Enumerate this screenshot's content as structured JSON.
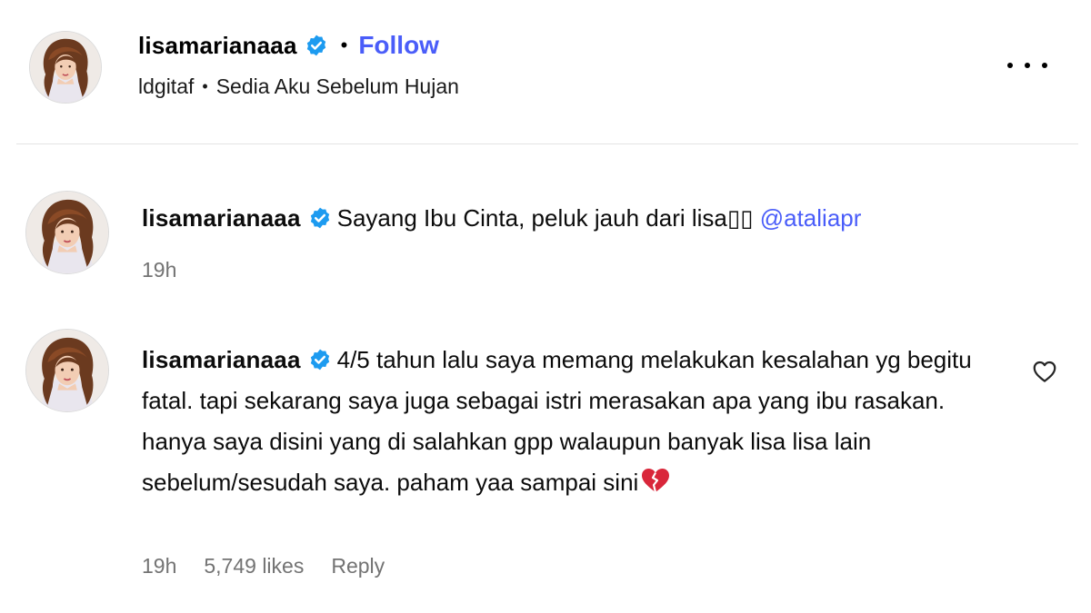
{
  "post_header": {
    "username": "lisamarianaaa",
    "follow_label": "Follow",
    "separator": "•",
    "audio_artist": "ldgitaf",
    "audio_title": "Sedia Aku Sebelum Hujan",
    "more_icon": "more-options-icon"
  },
  "comments": [
    {
      "username": "lisamarianaaa",
      "text": "Sayang Ibu Cinta, peluk jauh dari lisa▯▯",
      "mention": "@ataliapr",
      "time": "19h"
    },
    {
      "username": "lisamarianaaa",
      "text": "4/5 tahun lalu saya memang melakukan kesalahan yg begitu fatal. tapi sekarang saya juga sebagai istri merasakan apa yang ibu rasakan. hanya saya disini yang di salahkan gpp walaupun banyak lisa lisa lain sebelum/sesudah saya. paham yaa sampai sini",
      "emoji": "broken-heart",
      "time": "19h",
      "likes": "5,749 likes",
      "reply_label": "Reply",
      "like_icon": "heart-outline-icon"
    }
  ],
  "colors": {
    "link": "#4a5df9",
    "verified": "#1d9bf0",
    "meta_text": "#737373",
    "divider": "#e4e4e4"
  }
}
